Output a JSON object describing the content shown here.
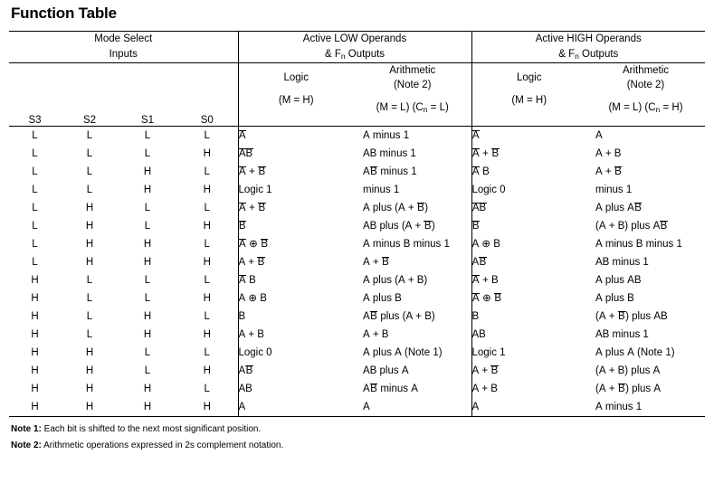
{
  "title": "Function Table",
  "header": {
    "group_mode": {
      "line1": "Mode Select",
      "line2": "Inputs"
    },
    "group_low": {
      "line1": "Active LOW Operands",
      "line2_pre": "& F",
      "line2_sub": "n",
      "line2_post": " Outputs"
    },
    "group_high": {
      "line1": "Active HIGH Operands",
      "line2_pre": "& F",
      "line2_sub": "n",
      "line2_post": " Outputs"
    },
    "logic_low": {
      "line1": "Logic",
      "line2": "",
      "line3": "(M = H)"
    },
    "arith_low": {
      "line1": "Arithmetic",
      "line2": "(Note 2)",
      "line3_pre": "(M = L) (C",
      "line3_sub": "n",
      "line3_post": " = L)"
    },
    "logic_high": {
      "line1": "Logic",
      "line2": "",
      "line3": "(M = H)"
    },
    "arith_high": {
      "line1": "Arithmetic",
      "line2": "(Note 2)",
      "line3_pre": "(M = L) (C",
      "line3_sub": "n",
      "line3_post": " = H)"
    },
    "select_labels": [
      "S3",
      "S2",
      "S1",
      "S0"
    ]
  },
  "rows": [
    {
      "s": [
        "L",
        "L",
        "L",
        "L"
      ],
      "logic_low": [
        {
          "t": "A",
          "ov": true
        }
      ],
      "arith_low": [
        {
          "t": "A minus 1"
        }
      ],
      "logic_high": [
        {
          "t": "A",
          "ov": true
        }
      ],
      "arith_high": [
        {
          "t": "A"
        }
      ]
    },
    {
      "s": [
        "L",
        "L",
        "L",
        "H"
      ],
      "logic_low": [
        {
          "t": "AB",
          "ov": true
        }
      ],
      "arith_low": [
        {
          "t": "AB minus 1"
        }
      ],
      "logic_high": [
        {
          "t": "A",
          "ov": true
        },
        {
          "t": " + "
        },
        {
          "t": "B",
          "ov": true
        }
      ],
      "arith_high": [
        {
          "t": "A + B"
        }
      ]
    },
    {
      "s": [
        "L",
        "L",
        "H",
        "L"
      ],
      "logic_low": [
        {
          "t": "A",
          "ov": true
        },
        {
          "t": " + "
        },
        {
          "t": "B",
          "ov": true
        }
      ],
      "arith_low": [
        {
          "t": "A"
        },
        {
          "t": "B",
          "ov": true
        },
        {
          "t": " minus 1"
        }
      ],
      "logic_high": [
        {
          "t": "A",
          "ov": true
        },
        {
          "t": " B"
        }
      ],
      "arith_high": [
        {
          "t": "A + "
        },
        {
          "t": "B",
          "ov": true
        }
      ]
    },
    {
      "s": [
        "L",
        "L",
        "H",
        "H"
      ],
      "logic_low": [
        {
          "t": "Logic 1"
        }
      ],
      "arith_low": [
        {
          "t": "minus 1"
        }
      ],
      "logic_high": [
        {
          "t": "Logic 0"
        }
      ],
      "arith_high": [
        {
          "t": "minus 1"
        }
      ]
    },
    {
      "s": [
        "L",
        "H",
        "L",
        "L"
      ],
      "logic_low": [
        {
          "t": "A",
          "ov": true
        },
        {
          "t": " + "
        },
        {
          "t": "B",
          "ov": true
        }
      ],
      "arith_low": [
        {
          "t": "A plus (A + "
        },
        {
          "t": "B",
          "ov": true
        },
        {
          "t": ")"
        }
      ],
      "logic_high": [
        {
          "t": "AB",
          "ov": true
        }
      ],
      "arith_high": [
        {
          "t": "A plus A"
        },
        {
          "t": "B",
          "ov": true
        }
      ]
    },
    {
      "s": [
        "L",
        "H",
        "L",
        "H"
      ],
      "logic_low": [
        {
          "t": "B",
          "ov": true
        }
      ],
      "arith_low": [
        {
          "t": "AB plus (A + "
        },
        {
          "t": "B",
          "ov": true
        },
        {
          "t": ")"
        }
      ],
      "logic_high": [
        {
          "t": "B",
          "ov": true
        }
      ],
      "arith_high": [
        {
          "t": "(A + B) plus A"
        },
        {
          "t": "B",
          "ov": true
        }
      ]
    },
    {
      "s": [
        "L",
        "H",
        "H",
        "L"
      ],
      "logic_low": [
        {
          "t": "A",
          "ov": true
        },
        {
          "t": " ⊕ "
        },
        {
          "t": "B",
          "ov": true
        }
      ],
      "arith_low": [
        {
          "t": "A minus B minus 1"
        }
      ],
      "logic_high": [
        {
          "t": "A ⊕ B"
        }
      ],
      "arith_high": [
        {
          "t": "A minus B minus 1"
        }
      ]
    },
    {
      "s": [
        "L",
        "H",
        "H",
        "H"
      ],
      "logic_low": [
        {
          "t": "A + "
        },
        {
          "t": "B",
          "ov": true
        }
      ],
      "arith_low": [
        {
          "t": "A + "
        },
        {
          "t": "B",
          "ov": true
        }
      ],
      "logic_high": [
        {
          "t": "A"
        },
        {
          "t": "B",
          "ov": true
        }
      ],
      "arith_high": [
        {
          "t": "AB minus 1"
        }
      ]
    },
    {
      "s": [
        "H",
        "L",
        "L",
        "L"
      ],
      "logic_low": [
        {
          "t": "A",
          "ov": true
        },
        {
          "t": " B"
        }
      ],
      "arith_low": [
        {
          "t": "A plus (A + B)"
        }
      ],
      "logic_high": [
        {
          "t": "A",
          "ov": true
        },
        {
          "t": " + B"
        }
      ],
      "arith_high": [
        {
          "t": "A plus AB"
        }
      ]
    },
    {
      "s": [
        "H",
        "L",
        "L",
        "H"
      ],
      "logic_low": [
        {
          "t": "A ⊕ B"
        }
      ],
      "arith_low": [
        {
          "t": "A plus B"
        }
      ],
      "logic_high": [
        {
          "t": "A",
          "ov": true
        },
        {
          "t": " ⊕ "
        },
        {
          "t": "B",
          "ov": true
        }
      ],
      "arith_high": [
        {
          "t": "A plus B"
        }
      ]
    },
    {
      "s": [
        "H",
        "L",
        "H",
        "L"
      ],
      "logic_low": [
        {
          "t": "B"
        }
      ],
      "arith_low": [
        {
          "t": "A"
        },
        {
          "t": "B",
          "ov": true
        },
        {
          "t": " plus (A + B)"
        }
      ],
      "logic_high": [
        {
          "t": "B"
        }
      ],
      "arith_high": [
        {
          "t": "(A + "
        },
        {
          "t": "B",
          "ov": true
        },
        {
          "t": ") plus AB"
        }
      ]
    },
    {
      "s": [
        "H",
        "L",
        "H",
        "H"
      ],
      "logic_low": [
        {
          "t": "A + B"
        }
      ],
      "arith_low": [
        {
          "t": "A + B"
        }
      ],
      "logic_high": [
        {
          "t": "AB"
        }
      ],
      "arith_high": [
        {
          "t": "AB minus 1"
        }
      ]
    },
    {
      "s": [
        "H",
        "H",
        "L",
        "L"
      ],
      "logic_low": [
        {
          "t": "Logic 0"
        }
      ],
      "arith_low": [
        {
          "t": "A plus A (Note 1)"
        }
      ],
      "logic_high": [
        {
          "t": "Logic 1"
        }
      ],
      "arith_high": [
        {
          "t": "A plus A (Note 1)"
        }
      ]
    },
    {
      "s": [
        "H",
        "H",
        "L",
        "H"
      ],
      "logic_low": [
        {
          "t": "A"
        },
        {
          "t": "B",
          "ov": true
        }
      ],
      "arith_low": [
        {
          "t": "AB plus A"
        }
      ],
      "logic_high": [
        {
          "t": "A + "
        },
        {
          "t": "B",
          "ov": true
        }
      ],
      "arith_high": [
        {
          "t": "(A + B) plus A"
        }
      ]
    },
    {
      "s": [
        "H",
        "H",
        "H",
        "L"
      ],
      "logic_low": [
        {
          "t": "AB"
        }
      ],
      "arith_low": [
        {
          "t": "A"
        },
        {
          "t": "B",
          "ov": true
        },
        {
          "t": " minus A"
        }
      ],
      "logic_high": [
        {
          "t": "A + B"
        }
      ],
      "arith_high": [
        {
          "t": "(A + "
        },
        {
          "t": "B",
          "ov": true
        },
        {
          "t": ") plus A"
        }
      ]
    },
    {
      "s": [
        "H",
        "H",
        "H",
        "H"
      ],
      "logic_low": [
        {
          "t": "A"
        }
      ],
      "arith_low": [
        {
          "t": "A"
        }
      ],
      "logic_high": [
        {
          "t": "A"
        }
      ],
      "arith_high": [
        {
          "t": "A minus 1"
        }
      ]
    }
  ],
  "notes": [
    {
      "label": "Note 1:",
      "text": " Each bit is shifted to the next most significant position."
    },
    {
      "label": "Note 2:",
      "text": " Arithmetic operations expressed in 2s complement notation."
    }
  ]
}
